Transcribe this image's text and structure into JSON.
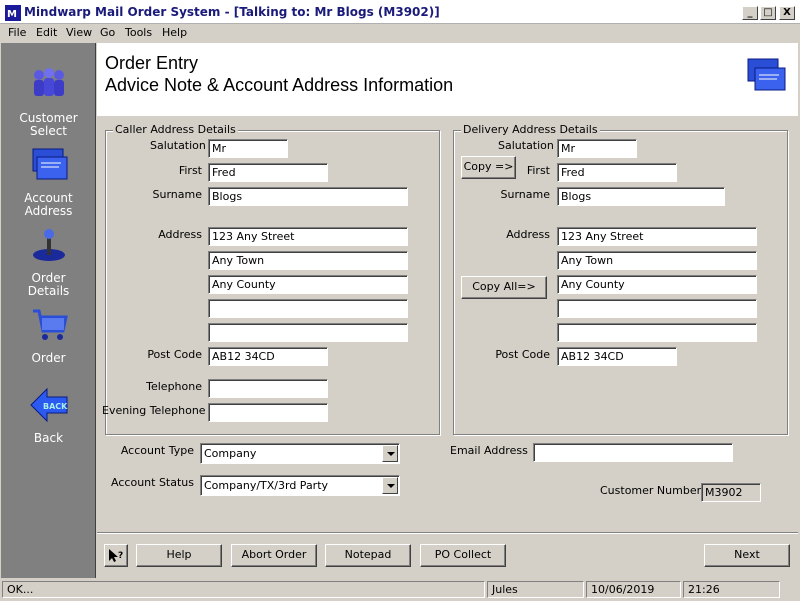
{
  "window": {
    "title": "Mindwarp Mail Order System - [Talking to: Mr Blogs (M3902)]",
    "minimize": "_",
    "maximize": "□",
    "close": "X"
  },
  "menu": [
    "File",
    "Edit",
    "View",
    "Go",
    "Tools",
    "Help"
  ],
  "sidebar": {
    "items": [
      {
        "label_1": "Customer",
        "label_2": "Select",
        "icon": "people-icon"
      },
      {
        "label_1": "Account",
        "label_2": "Address",
        "icon": "envelopes-icon"
      },
      {
        "label_1": "Order",
        "label_2": "Details",
        "icon": "joystick-icon"
      },
      {
        "label_1": "Order",
        "label_2": "",
        "icon": "shopping-cart-icon"
      },
      {
        "label_1": "Back",
        "label_2": "",
        "icon": "back-arrow-icon"
      }
    ]
  },
  "header": {
    "title": "Order Entry",
    "subtitle": "Advice Note & Account Address Information"
  },
  "caller": {
    "legend": "Caller Address Details",
    "salutation_label": "Salutation",
    "salutation": "Mr",
    "first_label": "First",
    "first": "Fred",
    "surname_label": "Surname",
    "surname": "Blogs",
    "address_label": "Address",
    "address": [
      "123 Any Street",
      "Any Town",
      "Any County",
      "",
      ""
    ],
    "postcode_label": "Post Code",
    "postcode": "AB12 34CD",
    "telephone_label": "Telephone",
    "telephone": "",
    "evening_label": "Evening Telephone",
    "evening": ""
  },
  "delivery": {
    "legend": "Delivery Address Details",
    "salutation_label": "Salutation",
    "salutation": "Mr",
    "copy_button": "Copy =>",
    "first_label": "First",
    "first": "Fred",
    "surname_label": "Surname",
    "surname": "Blogs",
    "address_label": "Address",
    "address": [
      "123 Any Street",
      "Any Town",
      "Any County",
      "",
      ""
    ],
    "copy_all_button": "Copy All=>",
    "postcode_label": "Post Code",
    "postcode": "AB12 34CD"
  },
  "account": {
    "type_label": "Account Type",
    "type_value": "Company",
    "status_label": "Account Status",
    "status_value": "Company/TX/3rd Party",
    "email_label": "Email Address",
    "email": "",
    "customer_number_label": "Customer Number",
    "customer_number": "M3902"
  },
  "footer": {
    "help": "Help",
    "abort": "Abort Order",
    "notepad": "Notepad",
    "po_collect": "PO Collect",
    "next": "Next"
  },
  "status": {
    "message": "OK...",
    "user": "Jules",
    "date": "10/06/2019",
    "time": "21:26"
  },
  "colors": {
    "sidebar": "#808080",
    "face": "#d4d0c8",
    "title_text": "#1a1a7a",
    "icon_blue": "#2a4fd6"
  }
}
